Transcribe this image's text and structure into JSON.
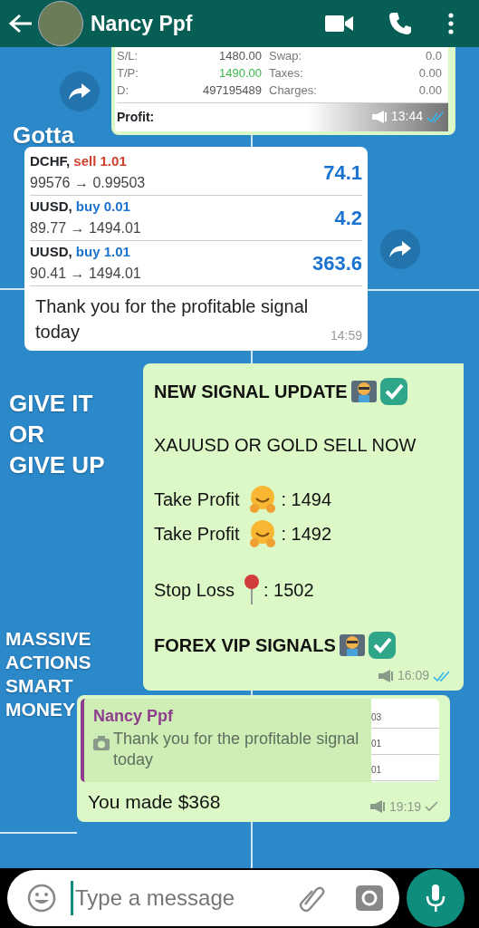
{
  "header": {
    "title": "Nancy Ppf"
  },
  "wallpaper_texts": [
    {
      "text": "Gotta",
      "kind": "small"
    },
    {
      "text": "GIVE IT",
      "kind": "big"
    },
    {
      "text": "OR",
      "kind": "big"
    },
    {
      "text": "GIVE UP",
      "kind": "big"
    },
    {
      "text": "MASSIVE",
      "kind": "word"
    },
    {
      "text": "ACTIONS",
      "kind": "word"
    },
    {
      "text": "SMART",
      "kind": "word"
    },
    {
      "text": "MONEY",
      "kind": "word"
    }
  ],
  "messages": [
    {
      "kind": "account",
      "outgoing": true,
      "forward_button": true,
      "read": true,
      "time": "13:44",
      "rows": [
        {
          "label": "S/L:",
          "value": "1480.00",
          "positive": false,
          "label2": "Swap:",
          "value2": "0.0"
        },
        {
          "label": "T/P:",
          "value": "1490.00",
          "positive": true,
          "label2": "Taxes:",
          "value2": "0.00"
        },
        {
          "label": "D:",
          "value": "497195489",
          "positive": false,
          "label2": "Charges:",
          "value2": "0.00"
        }
      ],
      "profit_label": "Profit:"
    },
    {
      "kind": "trades",
      "outgoing": false,
      "forward_button": true,
      "time": "14:59",
      "trades": [
        {
          "symbol": "DCHF,",
          "side": "sell 1.01",
          "sell": true,
          "prices": "99576 → 0.99503",
          "profit": "74.1"
        },
        {
          "symbol": "UUSD,",
          "side": "buy 0.01",
          "sell": false,
          "prices": "89.77 → 1494.01",
          "profit": "4.2"
        },
        {
          "symbol": "UUSD,",
          "side": "buy 1.01",
          "sell": false,
          "prices": "90.41 → 1494.01",
          "profit": "363.6"
        }
      ],
      "caption": "Thank you for the profitable signal today"
    },
    {
      "kind": "text",
      "outgoing": true,
      "forward_button": false,
      "read": true,
      "time": "16:09",
      "lines": [
        {
          "kind": "headline",
          "gap_before": false,
          "text": "NEW SIGNAL UPDATE"
        },
        {
          "kind": "plain",
          "gap_before": true,
          "text": "XAUUSD OR GOLD SELL NOW"
        },
        {
          "kind": "target",
          "gap_before": true,
          "text": "Take Profit",
          "value": ": 1494"
        },
        {
          "kind": "target",
          "gap_before": false,
          "text": "Take Profit",
          "value": ": 1492"
        },
        {
          "kind": "stop",
          "gap_before": true,
          "text": "Stop Loss",
          "value": ": 1502"
        },
        {
          "kind": "headline",
          "gap_before": true,
          "text": "FOREX VIP SIGNALS"
        }
      ]
    },
    {
      "kind": "reply",
      "outgoing": true,
      "forward_button": false,
      "read": false,
      "time": "19:19",
      "quote": {
        "author": "Nancy Ppf",
        "text": "Thank you for the profitable signal today",
        "thumbnail_texts": [
          "03",
          "01",
          "01"
        ]
      },
      "text": "You made $368"
    }
  ],
  "composer": {
    "placeholder": "Type a message"
  }
}
